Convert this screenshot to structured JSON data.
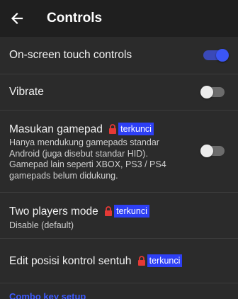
{
  "app_bar": {
    "title": "Controls",
    "back_icon": "arrow-left-icon"
  },
  "settings": {
    "touch_controls": {
      "label": "On-screen touch controls",
      "enabled": true
    },
    "vibrate": {
      "label": "Vibrate",
      "enabled": false
    },
    "gamepad": {
      "label": "Masukan gamepad",
      "badge": "terkunci",
      "summary_lines": [
        "Hanya mendukung gamepads standar",
        "Android (juga disebut standar HID).",
        "Gamepad lain seperti XBOX, PS3 / PS4",
        "gamepads belum didukung."
      ],
      "enabled": false
    },
    "two_players": {
      "label": "Two players mode",
      "badge": "terkunci",
      "summary": "Disable (default)"
    },
    "edit_position": {
      "label": "Edit posisi kontrol sentuh",
      "badge": "terkunci"
    },
    "combo_key": {
      "label": "Combo key setup"
    }
  },
  "colors": {
    "accent": "#3b56f5",
    "badge_bg": "#2d3ff5",
    "lock": "#e53935",
    "background": "#2b2b2b",
    "app_bar": "#1f1f1f"
  }
}
